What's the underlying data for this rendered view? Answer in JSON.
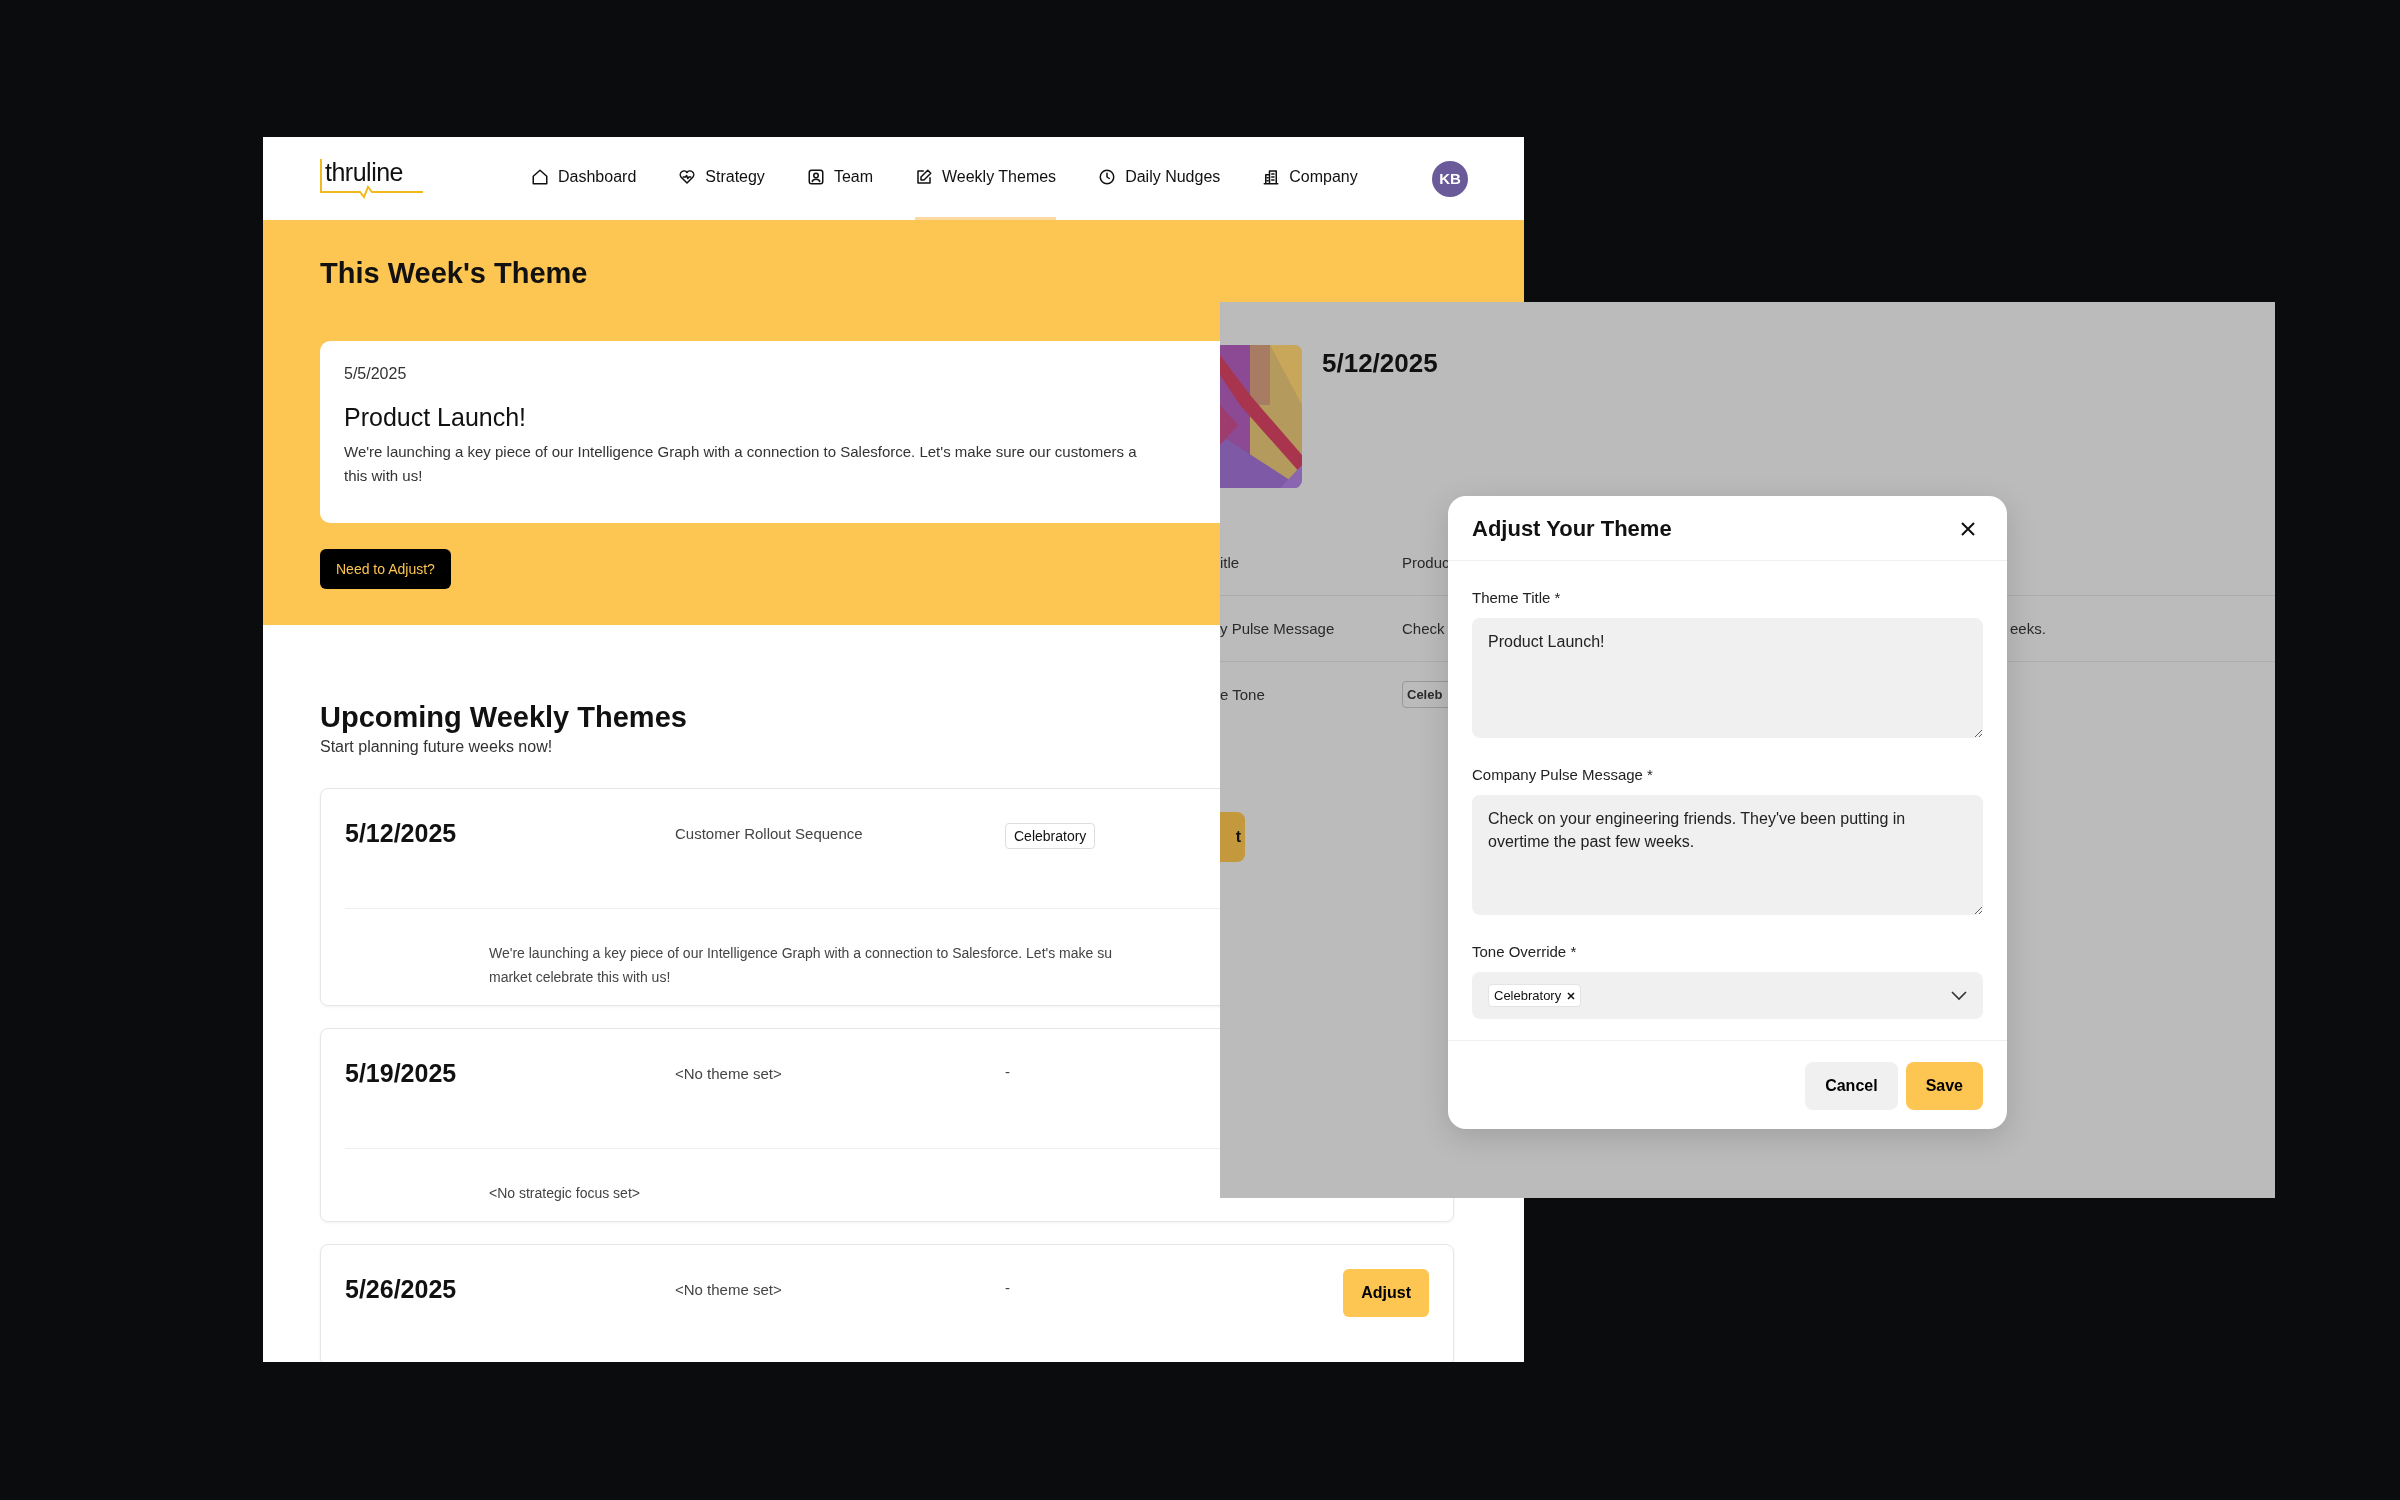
{
  "nav": {
    "logo": "thruline",
    "items": [
      {
        "label": "Dashboard",
        "selected": false
      },
      {
        "label": "Strategy",
        "selected": false
      },
      {
        "label": "Team",
        "selected": false
      },
      {
        "label": "Weekly Themes",
        "selected": true
      },
      {
        "label": "Daily Nudges",
        "selected": false
      },
      {
        "label": "Company",
        "selected": false
      }
    ],
    "avatar": "KB"
  },
  "current_theme": {
    "heading": "This Week's Theme",
    "date": "5/5/2025",
    "title": "Product Launch!",
    "message_lines": [
      "We're launching a key piece of our Intelligence Graph with a connection to Salesforce. Let's make sure our customers a",
      "this with us!"
    ],
    "button": "Need to Adjust?"
  },
  "upcoming": {
    "heading": "Upcoming Weekly Themes",
    "subtitle": "Start planning future weeks now!",
    "weeks": [
      {
        "date": "5/12/2025",
        "title": "Customer Rollout Sequence",
        "tone": {
          "kind": "tag",
          "text": "Celebratory"
        },
        "focus_lines": [
          "We're launching a key piece of our Intelligence Graph with a connection to Salesforce. Let's make su",
          "market celebrate this with us!"
        ]
      },
      {
        "date": "5/19/2025",
        "title": "<No theme set>",
        "tone": {
          "kind": "plain",
          "text": "-"
        },
        "focus_lines": [
          "<No strategic focus set>"
        ]
      },
      {
        "date": "5/26/2025",
        "title": "<No theme set>",
        "tone": {
          "kind": "plain",
          "text": "-"
        },
        "button": "Adjust"
      }
    ]
  },
  "detail_panel": {
    "date": "5/12/2025",
    "rows": [
      {
        "label": "itle",
        "value": "Produc"
      },
      {
        "label": "y Pulse Message",
        "value": "Check",
        "value_end": "eeks."
      },
      {
        "label": "e Tone",
        "tag": "Celeb"
      }
    ],
    "button": "t"
  },
  "modal": {
    "title": "Adjust Your Theme",
    "fields": [
      {
        "kind": "textarea",
        "label": "Theme Title *",
        "value": "Product Launch!"
      },
      {
        "kind": "textarea",
        "label": "Company Pulse Message *",
        "value": "Check on your engineering friends. They've been putting in overtime the past few weeks."
      },
      {
        "kind": "select",
        "label": "Tone Override *",
        "chips": [
          "Celebratory"
        ]
      }
    ],
    "buttons": [
      {
        "kind": "secondary",
        "label": "Cancel"
      },
      {
        "kind": "primary",
        "label": "Save"
      }
    ]
  }
}
